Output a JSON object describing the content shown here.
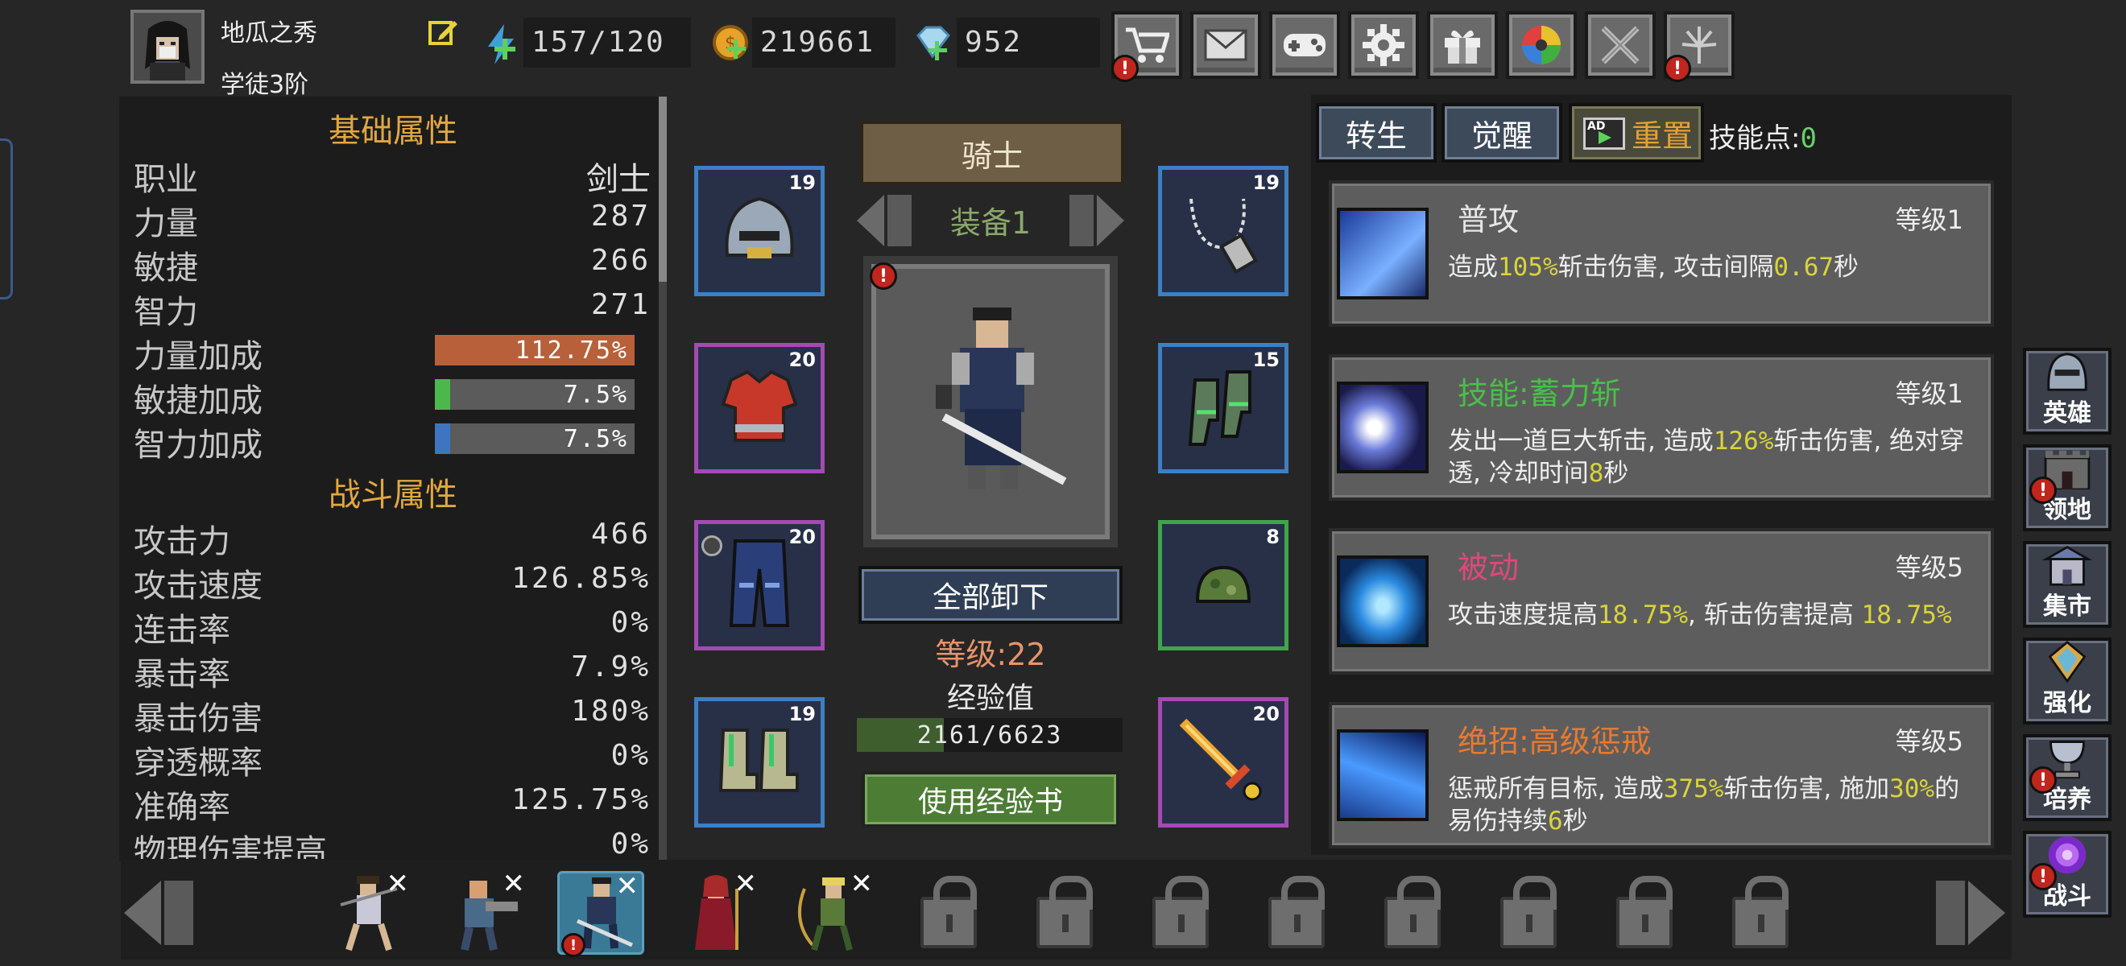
{
  "player": {
    "name": "地瓜之秀",
    "rank": "学徒3阶",
    "avatar_icon": "player-avatar"
  },
  "resources": {
    "energy": "157/120",
    "gold": "219661",
    "diamond": "952"
  },
  "topbar": {
    "buttons": [
      {
        "name": "shop-button",
        "icon": "cart-icon",
        "alert": true
      },
      {
        "name": "mail-button",
        "icon": "mail-icon",
        "alert": false
      },
      {
        "name": "gamepad-button",
        "icon": "gamepad-icon",
        "alert": false
      },
      {
        "name": "settings-button",
        "icon": "gear-icon",
        "alert": false
      },
      {
        "name": "gift-button",
        "icon": "gift-icon",
        "alert": false
      },
      {
        "name": "wheel-button",
        "icon": "color-wheel-icon",
        "alert": false
      },
      {
        "name": "battle-button",
        "icon": "crossed-swords-icon",
        "alert": false
      },
      {
        "name": "fireworks-button",
        "icon": "fireworks-icon",
        "alert": true
      }
    ],
    "alert_mark": "!"
  },
  "attributes": {
    "basic_title": "基础属性",
    "rows": [
      {
        "label": "职业",
        "value": "剑士"
      },
      {
        "label": "力量",
        "value": "287"
      },
      {
        "label": "敏捷",
        "value": "266"
      },
      {
        "label": "智力",
        "value": "271"
      }
    ],
    "bonuses": [
      {
        "label": "力量加成",
        "value": "112.75%",
        "fill": 1.0,
        "color": "#b8603a"
      },
      {
        "label": "敏捷加成",
        "value": "7.5%",
        "fill": 0.075,
        "color": "#4cb84c"
      },
      {
        "label": "智力加成",
        "value": "7.5%",
        "fill": 0.075,
        "color": "#3e74c0"
      }
    ],
    "combat_title": "战斗属性",
    "combat": [
      {
        "label": "攻击力",
        "value": "466"
      },
      {
        "label": "攻击速度",
        "value": "126.85%"
      },
      {
        "label": "连击率",
        "value": "0%"
      },
      {
        "label": "暴击率",
        "value": "7.9%"
      },
      {
        "label": "暴击伤害",
        "value": "180%"
      },
      {
        "label": "穿透概率",
        "value": "0%"
      },
      {
        "label": "准确率",
        "value": "125.75%"
      },
      {
        "label": "物理伤害提高",
        "value": "0%"
      }
    ]
  },
  "equipment": {
    "class": "骑士",
    "set_label": "装备1",
    "slots": [
      {
        "name": "helmet-slot",
        "level": "19",
        "rarity": "blue"
      },
      {
        "name": "armor-slot",
        "level": "20",
        "rarity": "purple"
      },
      {
        "name": "pants-slot",
        "level": "20",
        "rarity": "purple"
      },
      {
        "name": "boots-slot",
        "level": "19",
        "rarity": "blue"
      },
      {
        "name": "necklace-slot",
        "level": "19",
        "rarity": "blue"
      },
      {
        "name": "gloves-slot",
        "level": "15",
        "rarity": "blue"
      },
      {
        "name": "ring-slot",
        "level": "8",
        "rarity": "green"
      },
      {
        "name": "sword-slot",
        "level": "20",
        "rarity": "purple"
      }
    ],
    "unequip_all": "全部卸下",
    "level_text": "等级:22",
    "exp_label": "经验值",
    "exp_text": "2161/6623",
    "exp_fraction": 0.326,
    "use_exp_book": "使用经验书"
  },
  "skills": {
    "tabs": [
      "转生",
      "觉醒"
    ],
    "reset_label": "重置",
    "ad_label": "AD",
    "points_label": "技能点:",
    "points_value": "0",
    "cards": [
      {
        "name": "普攻",
        "name_color": "#e6e6e6",
        "level": "等级1",
        "desc": [
          {
            "t": "造成"
          },
          {
            "t": "105%",
            "y": true
          },
          {
            "t": "斩击伤害, 攻击间隔"
          },
          {
            "t": "0.67",
            "y": true
          },
          {
            "t": "秒"
          }
        ]
      },
      {
        "name": "技能:蓄力斩",
        "name_color": "#48c048",
        "level": "等级1",
        "desc": [
          {
            "t": "发出一道巨大斩击, 造成"
          },
          {
            "t": "126%",
            "y": true
          },
          {
            "t": "斩击伤害, 绝对穿透, 冷却时间"
          },
          {
            "t": "8",
            "y": true
          },
          {
            "t": "秒"
          }
        ]
      },
      {
        "name": "被动",
        "name_color": "#e0487a",
        "level": "等级5",
        "desc": [
          {
            "t": "攻击速度提高"
          },
          {
            "t": "18.75%",
            "y": true
          },
          {
            "t": ", 斩击伤害提高 "
          },
          {
            "t": "18.75%",
            "y": true
          }
        ]
      },
      {
        "name": "绝招:高级惩戒",
        "name_color": "#e87a30",
        "level": "等级5",
        "desc": [
          {
            "t": "惩戒所有目标, 造成"
          },
          {
            "t": "375%",
            "y": true
          },
          {
            "t": "斩击伤害, 施加"
          },
          {
            "t": "30%",
            "y": true
          },
          {
            "t": "的易伤持续"
          },
          {
            "t": "6",
            "y": true
          },
          {
            "t": "秒"
          }
        ]
      }
    ]
  },
  "sidenav": [
    {
      "label": "英雄",
      "icon": "helmet-icon",
      "alert": false
    },
    {
      "label": "领地",
      "icon": "castle-icon",
      "alert": true
    },
    {
      "label": "集市",
      "icon": "market-icon",
      "alert": false
    },
    {
      "label": "强化",
      "icon": "crystal-icon",
      "alert": false
    },
    {
      "label": "培养",
      "icon": "chalice-icon",
      "alert": true
    },
    {
      "label": "战斗",
      "icon": "portal-icon",
      "alert": true
    }
  ],
  "heroes": {
    "unlocked": 5,
    "selected": 2,
    "total": 13
  }
}
